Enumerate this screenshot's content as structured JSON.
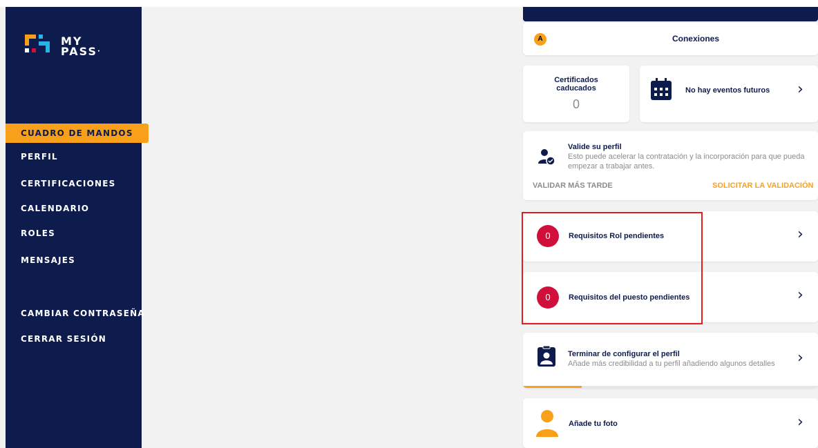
{
  "app": {
    "logo_line1": "MY",
    "logo_line2": "PASS"
  },
  "sidebar": {
    "items": [
      {
        "label": "CUADRO DE MANDOS",
        "active": true
      },
      {
        "label": "PERFIL"
      },
      {
        "label": "CERTIFICACIONES"
      },
      {
        "label": "CALENDARIO"
      },
      {
        "label": "ROLES"
      },
      {
        "label": "MENSAJES"
      },
      {
        "label": "CAMBIAR CONTRASEÑA"
      },
      {
        "label": "CERRAR SESIÓN"
      }
    ]
  },
  "connections": {
    "badge": "A",
    "label": "Conexiones"
  },
  "certificates": {
    "label": "Certificados caducados",
    "count": "0"
  },
  "events": {
    "label": "No hay eventos futuros"
  },
  "validate": {
    "title": "Valide su perfil",
    "description": "Esto puede acelerar la contratación y la incorporación para que pueda empezar a trabajar antes.",
    "later_label": "VALIDAR MÁS TARDE",
    "request_label": "SOLICITAR LA VALIDACIÓN"
  },
  "requirements": [
    {
      "count": "0",
      "label": "Requisitos Rol pendientes"
    },
    {
      "count": "0",
      "label": "Requisitos del puesto pendientes"
    }
  ],
  "profile_setup": {
    "title": "Terminar de configurar el perfil",
    "subtitle": "Añade más credibilidad a tu perfil añadiendo algunos detalles",
    "progress": 0.2
  },
  "photo": {
    "label": "Añade tu foto"
  },
  "colors": {
    "navy": "#0e1b4d",
    "orange": "#f9a01b",
    "red": "#d0103a",
    "highlight": "#e61c1c"
  }
}
